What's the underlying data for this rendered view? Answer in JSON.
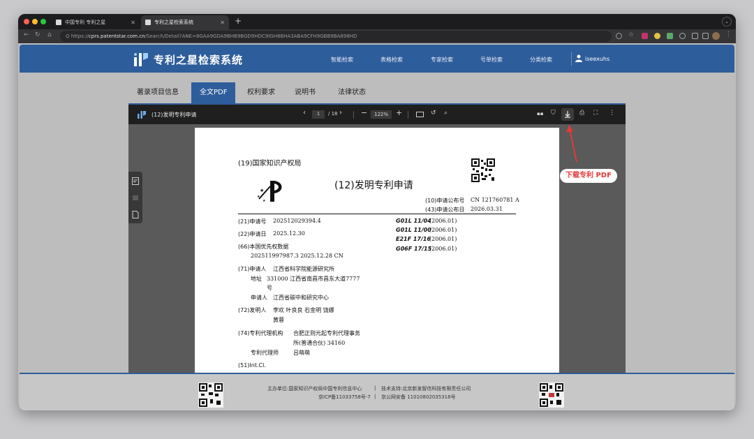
{
  "browser": {
    "tabs": [
      {
        "label": "中国专利 专利之星"
      },
      {
        "label": "专利之星检索系统"
      }
    ],
    "url_scheme": "https://",
    "url_host": "cprs.patentstar.com.cn",
    "url_path": "/Search/Detail?ANE=8GAA9GDA9BHB9BGD9HDC9IGH8BHA3ABA9CFH9GBB9BA898HD"
  },
  "site": {
    "title": "专利之星检索系统",
    "nav": [
      "智能检索",
      "表格检索",
      "专家检索",
      "号单检索",
      "分类检索"
    ],
    "user": "iseexuhs"
  },
  "tabs": [
    {
      "label": "著录项目信息"
    },
    {
      "label": "全文PDF"
    },
    {
      "label": "权利要求"
    },
    {
      "label": "说明书"
    },
    {
      "label": "法律状态"
    }
  ],
  "viewer": {
    "title": "(12)发明专利申请",
    "page_current": "1",
    "page_total": "/ 18",
    "zoom": "122%"
  },
  "document": {
    "office": "(19)国家知识产权局",
    "kind": "(12)发明专利申请",
    "pub_no_label": "(10)申请公布号",
    "pub_no": "CN 121760781 A",
    "pub_date_label": "(43)申请公布日",
    "pub_date": "2026.03.31",
    "app_no_label": "(21)申请号",
    "app_no": "2025120293​94.4",
    "app_date_label": "(22)申请日",
    "app_date": "2025.12.30",
    "priority_label": "(66)本国优先权数据",
    "priority": "202511997987.3 2025.12.28 CN",
    "applicant1_label": "(71)申请人",
    "applicant1": "江西省科学院能源研究所",
    "address_label": "地址",
    "address_line1": "331000 江西省南昌市昌东大道7777",
    "address_line2": "号",
    "applicant2_label": "申请人",
    "applicant2": "江西省碳中和研究中心",
    "inventors_label": "(72)发明人",
    "inventors_line1": "李欢  叶良良  石金明  饶娜",
    "inventors_line2": "黄蓉",
    "agency_label": "(74)专利代理机构",
    "agency_line1": "合肥正则元起专利代理事务",
    "agency_line2": "所(普通合伙) 34160",
    "agent_label": "专利代理师",
    "agent": "吕萌萌",
    "intcl_label": "(51)Int.Cl.",
    "classifications": [
      {
        "code": "G01L 11/04",
        "year": "(2006.01)"
      },
      {
        "code": "G01L 11/00",
        "year": "(2006.01)"
      },
      {
        "code": "E21F 17/16",
        "year": "(2006.01)"
      },
      {
        "code": "G06F 17/15",
        "year": "(2006.01)"
      }
    ]
  },
  "footer": {
    "line1_left": "主办单位:国家知识产权局中国专利信息中心",
    "line1_right": "技术支持:北京新发智信科技有限责任公司",
    "line2_left": "京ICP备11033758号-7",
    "line2_right": "京公网安备 11010802035318号",
    "separator": "|"
  },
  "annotation": {
    "label": "下载专利 PDF",
    "color": "#e23a3a"
  },
  "colors": {
    "brand_blue": "#2e5d9b",
    "annotation_red": "#e23a3a"
  }
}
